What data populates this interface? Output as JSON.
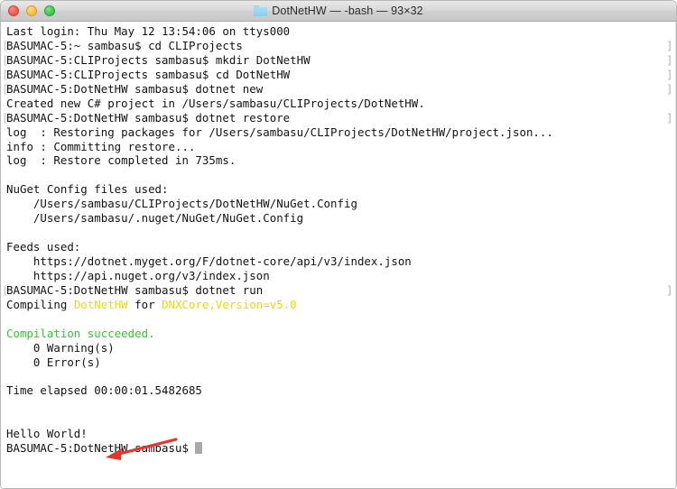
{
  "window": {
    "title": "DotNetHW — -bash — 93×32",
    "folder_icon": "folder-icon",
    "traffic_lights": [
      {
        "name": "close-button",
        "color": "#ee5349"
      },
      {
        "name": "minimize-button",
        "color": "#f9b938"
      },
      {
        "name": "zoom-button",
        "color": "#33c34a"
      }
    ]
  },
  "terminal": {
    "prompt_mark_glyph": "]",
    "left_mark_glyph": "[",
    "cursor": "block-cursor",
    "colors": {
      "foreground": "#131313",
      "background": "#ffffff",
      "yellow": "#e2e200",
      "green": "#32c832",
      "mark": "#b4b4b4"
    },
    "lines": [
      {
        "text": "Last login: Thu May 12 13:54:06 on ttys000",
        "prompt": false
      },
      {
        "text": "BASUMAC-5:~ sambasu$ cd CLIProjects",
        "prompt": true
      },
      {
        "text": "BASUMAC-5:CLIProjects sambasu$ mkdir DotNetHW",
        "prompt": true
      },
      {
        "text": "BASUMAC-5:CLIProjects sambasu$ cd DotNetHW",
        "prompt": true
      },
      {
        "text": "BASUMAC-5:DotNetHW sambasu$ dotnet new",
        "prompt": true
      },
      {
        "text": "Created new C# project in /Users/sambasu/CLIProjects/DotNetHW.",
        "prompt": false
      },
      {
        "text": "BASUMAC-5:DotNetHW sambasu$ dotnet restore",
        "prompt": true
      },
      {
        "text": "log  : Restoring packages for /Users/sambasu/CLIProjects/DotNetHW/project.json...",
        "prompt": false
      },
      {
        "text": "info : Committing restore...",
        "prompt": false
      },
      {
        "text": "log  : Restore completed in 735ms.",
        "prompt": false
      },
      {
        "text": "",
        "prompt": false
      },
      {
        "text": "NuGet Config files used:",
        "prompt": false
      },
      {
        "text": "    /Users/sambasu/CLIProjects/DotNetHW/NuGet.Config",
        "prompt": false
      },
      {
        "text": "    /Users/sambasu/.nuget/NuGet/NuGet.Config",
        "prompt": false
      },
      {
        "text": "",
        "prompt": false
      },
      {
        "text": "Feeds used:",
        "prompt": false
      },
      {
        "text": "    https://dotnet.myget.org/F/dotnet-core/api/v3/index.json",
        "prompt": false
      },
      {
        "text": "    https://api.nuget.org/v3/index.json",
        "prompt": false
      },
      {
        "text": "BASUMAC-5:DotNetHW sambasu$ dotnet run",
        "prompt": true
      },
      {
        "text": "Compiling DotNetHW for DNXCore,Version=v5.0",
        "prompt": false
      },
      {
        "text": "",
        "prompt": false
      },
      {
        "text": "Compilation succeeded.",
        "prompt": false
      },
      {
        "text": "    0 Warning(s)",
        "prompt": false
      },
      {
        "text": "    0 Error(s)",
        "prompt": false
      },
      {
        "text": "",
        "prompt": false
      },
      {
        "text": "Time elapsed 00:00:01.5482685",
        "prompt": false
      },
      {
        "text": "",
        "prompt": false
      },
      {
        "text": "",
        "prompt": false
      },
      {
        "text": "Hello World!",
        "prompt": false
      },
      {
        "text": "BASUMAC-5:DotNetHW sambasu$ ",
        "prompt": false
      }
    ],
    "compiling_line": {
      "prefix": "Compiling ",
      "project": "DotNetHW",
      "middle": " for ",
      "framework": "DNXCore,Version=v5.0"
    },
    "success_line": "Compilation succeeded.",
    "hello_output": "Hello World!",
    "final_prompt": "BASUMAC-5:DotNetHW sambasu$ "
  },
  "annotation": {
    "arrow_color": "#e3352b",
    "points_at": "Hello World!"
  }
}
